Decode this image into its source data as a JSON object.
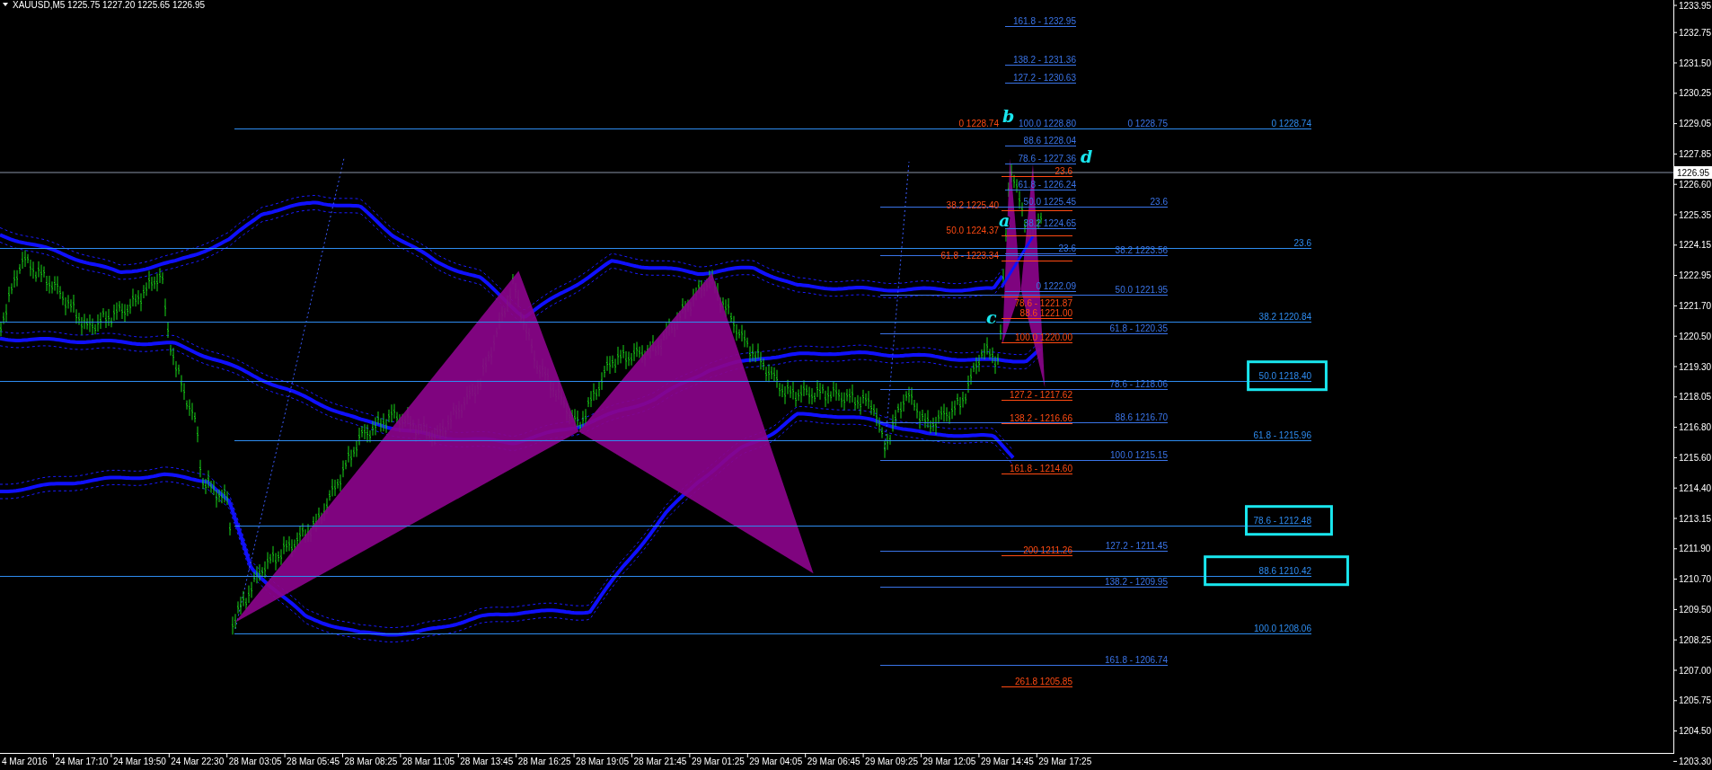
{
  "header": {
    "symbol_text": "XAUUSD,M5  1225.75 1227.20 1225.65 1226.95"
  },
  "price_axis": {
    "labels": [
      "1233.95",
      "1232.75",
      "1231.50",
      "1230.25",
      "1229.05",
      "1227.85",
      "1226.60",
      "1225.35",
      "1224.15",
      "1222.95",
      "1221.70",
      "1220.50",
      "1219.30",
      "1218.05",
      "1216.80",
      "1215.60",
      "1214.40",
      "1213.15",
      "1211.90",
      "1210.70",
      "1209.50",
      "1208.25",
      "1207.00",
      "1205.75",
      "1204.50",
      "1203.30"
    ],
    "current_price": "1226.95"
  },
  "time_axis": {
    "labels": [
      "4 Mar 2016",
      "24 Mar 17:10",
      "24 Mar 19:50",
      "24 Mar 22:30",
      "28 Mar 03:05",
      "28 Mar 05:45",
      "28 Mar 08:25",
      "28 Mar 11:05",
      "28 Mar 13:45",
      "28 Mar 16:25",
      "28 Mar 19:05",
      "28 Mar 21:45",
      "29 Mar 01:25",
      "29 Mar 04:05",
      "29 Mar 06:45",
      "29 Mar 09:25",
      "29 Mar 12:05",
      "29 Mar 14:45",
      "29 Mar 17:25"
    ]
  },
  "pattern_labels": [
    "b",
    "d",
    "a",
    "c"
  ],
  "fib_sets": [
    {
      "color": "#3a74e8",
      "levels": [
        {
          "text": "161.8 -  1232.95",
          "highlighted": false
        },
        {
          "text": "138.2 - 1231.36",
          "highlighted": false
        },
        {
          "text": "127.2 - 1230.63",
          "highlighted": false
        },
        {
          "text": "100.0 1228.80",
          "highlighted": false
        },
        {
          "text": "88.6 1228.04",
          "highlighted": false
        },
        {
          "text": "78.6 - 1227.36",
          "highlighted": false
        },
        {
          "text": "61.8 - 1226.24",
          "highlighted": false
        },
        {
          "text": "50.0 1225.45",
          "highlighted": false
        },
        {
          "text": "38.2 1224.65",
          "highlighted": false
        },
        {
          "text": "23.6",
          "highlighted": false
        },
        {
          "text": "0 1222.09",
          "highlighted": false
        }
      ]
    },
    {
      "color": "#ff4a12",
      "levels": [
        {
          "text": "0 1228.74",
          "highlighted": false
        },
        {
          "text": "23.6",
          "highlighted": false
        },
        {
          "text": "38.2 1225.40",
          "highlighted": false
        },
        {
          "text": "50.0 1224.37",
          "highlighted": false
        },
        {
          "text": "61.8 - 1223.34",
          "highlighted": false
        },
        {
          "text": "78.6 - 1221.87",
          "highlighted": false
        },
        {
          "text": "88.6 1221.00",
          "highlighted": false
        },
        {
          "text": "100.0 1220.00",
          "highlighted": false
        },
        {
          "text": "127.2 - 1217.62",
          "highlighted": false
        },
        {
          "text": "138.2 - 1216.66",
          "highlighted": false
        },
        {
          "text": "161.8 -  1214.60",
          "highlighted": false
        },
        {
          "text": "200  1211.26",
          "highlighted": false
        },
        {
          "text": "261.8 1205.85",
          "highlighted": false
        }
      ]
    },
    {
      "color": "#3a74e8",
      "levels": [
        {
          "text": "0 1228.75",
          "highlighted": false
        },
        {
          "text": "23.6",
          "highlighted": false
        },
        {
          "text": "38.2 1223.56",
          "highlighted": false
        },
        {
          "text": "50.0 1221.95",
          "highlighted": false
        },
        {
          "text": "61.8 - 1220.35",
          "highlighted": false
        },
        {
          "text": "78.6 - 1218.06",
          "highlighted": false
        },
        {
          "text": "88.6 1216.70",
          "highlighted": false
        },
        {
          "text": "100.0 1215.15",
          "highlighted": false
        },
        {
          "text": "127.2 - 1211.45",
          "highlighted": false
        },
        {
          "text": "138.2 - 1209.95",
          "highlighted": false
        },
        {
          "text": "161.8 -  1206.74",
          "highlighted": false
        }
      ]
    },
    {
      "color": "#2e8cf0",
      "levels": [
        {
          "text": "0 1228.74",
          "highlighted": false
        },
        {
          "text": "23.6",
          "highlighted": false
        },
        {
          "text": "38.2 1220.84",
          "highlighted": false
        },
        {
          "text": "50.0 1218.40",
          "highlighted": true
        },
        {
          "text": "61.8 - 1215.96",
          "highlighted": false
        },
        {
          "text": "78.6 - 1212.48",
          "highlighted": true
        },
        {
          "text": "88.6 1210.42",
          "highlighted": true
        },
        {
          "text": "100.0 1208.06",
          "highlighted": false
        }
      ]
    }
  ]
}
